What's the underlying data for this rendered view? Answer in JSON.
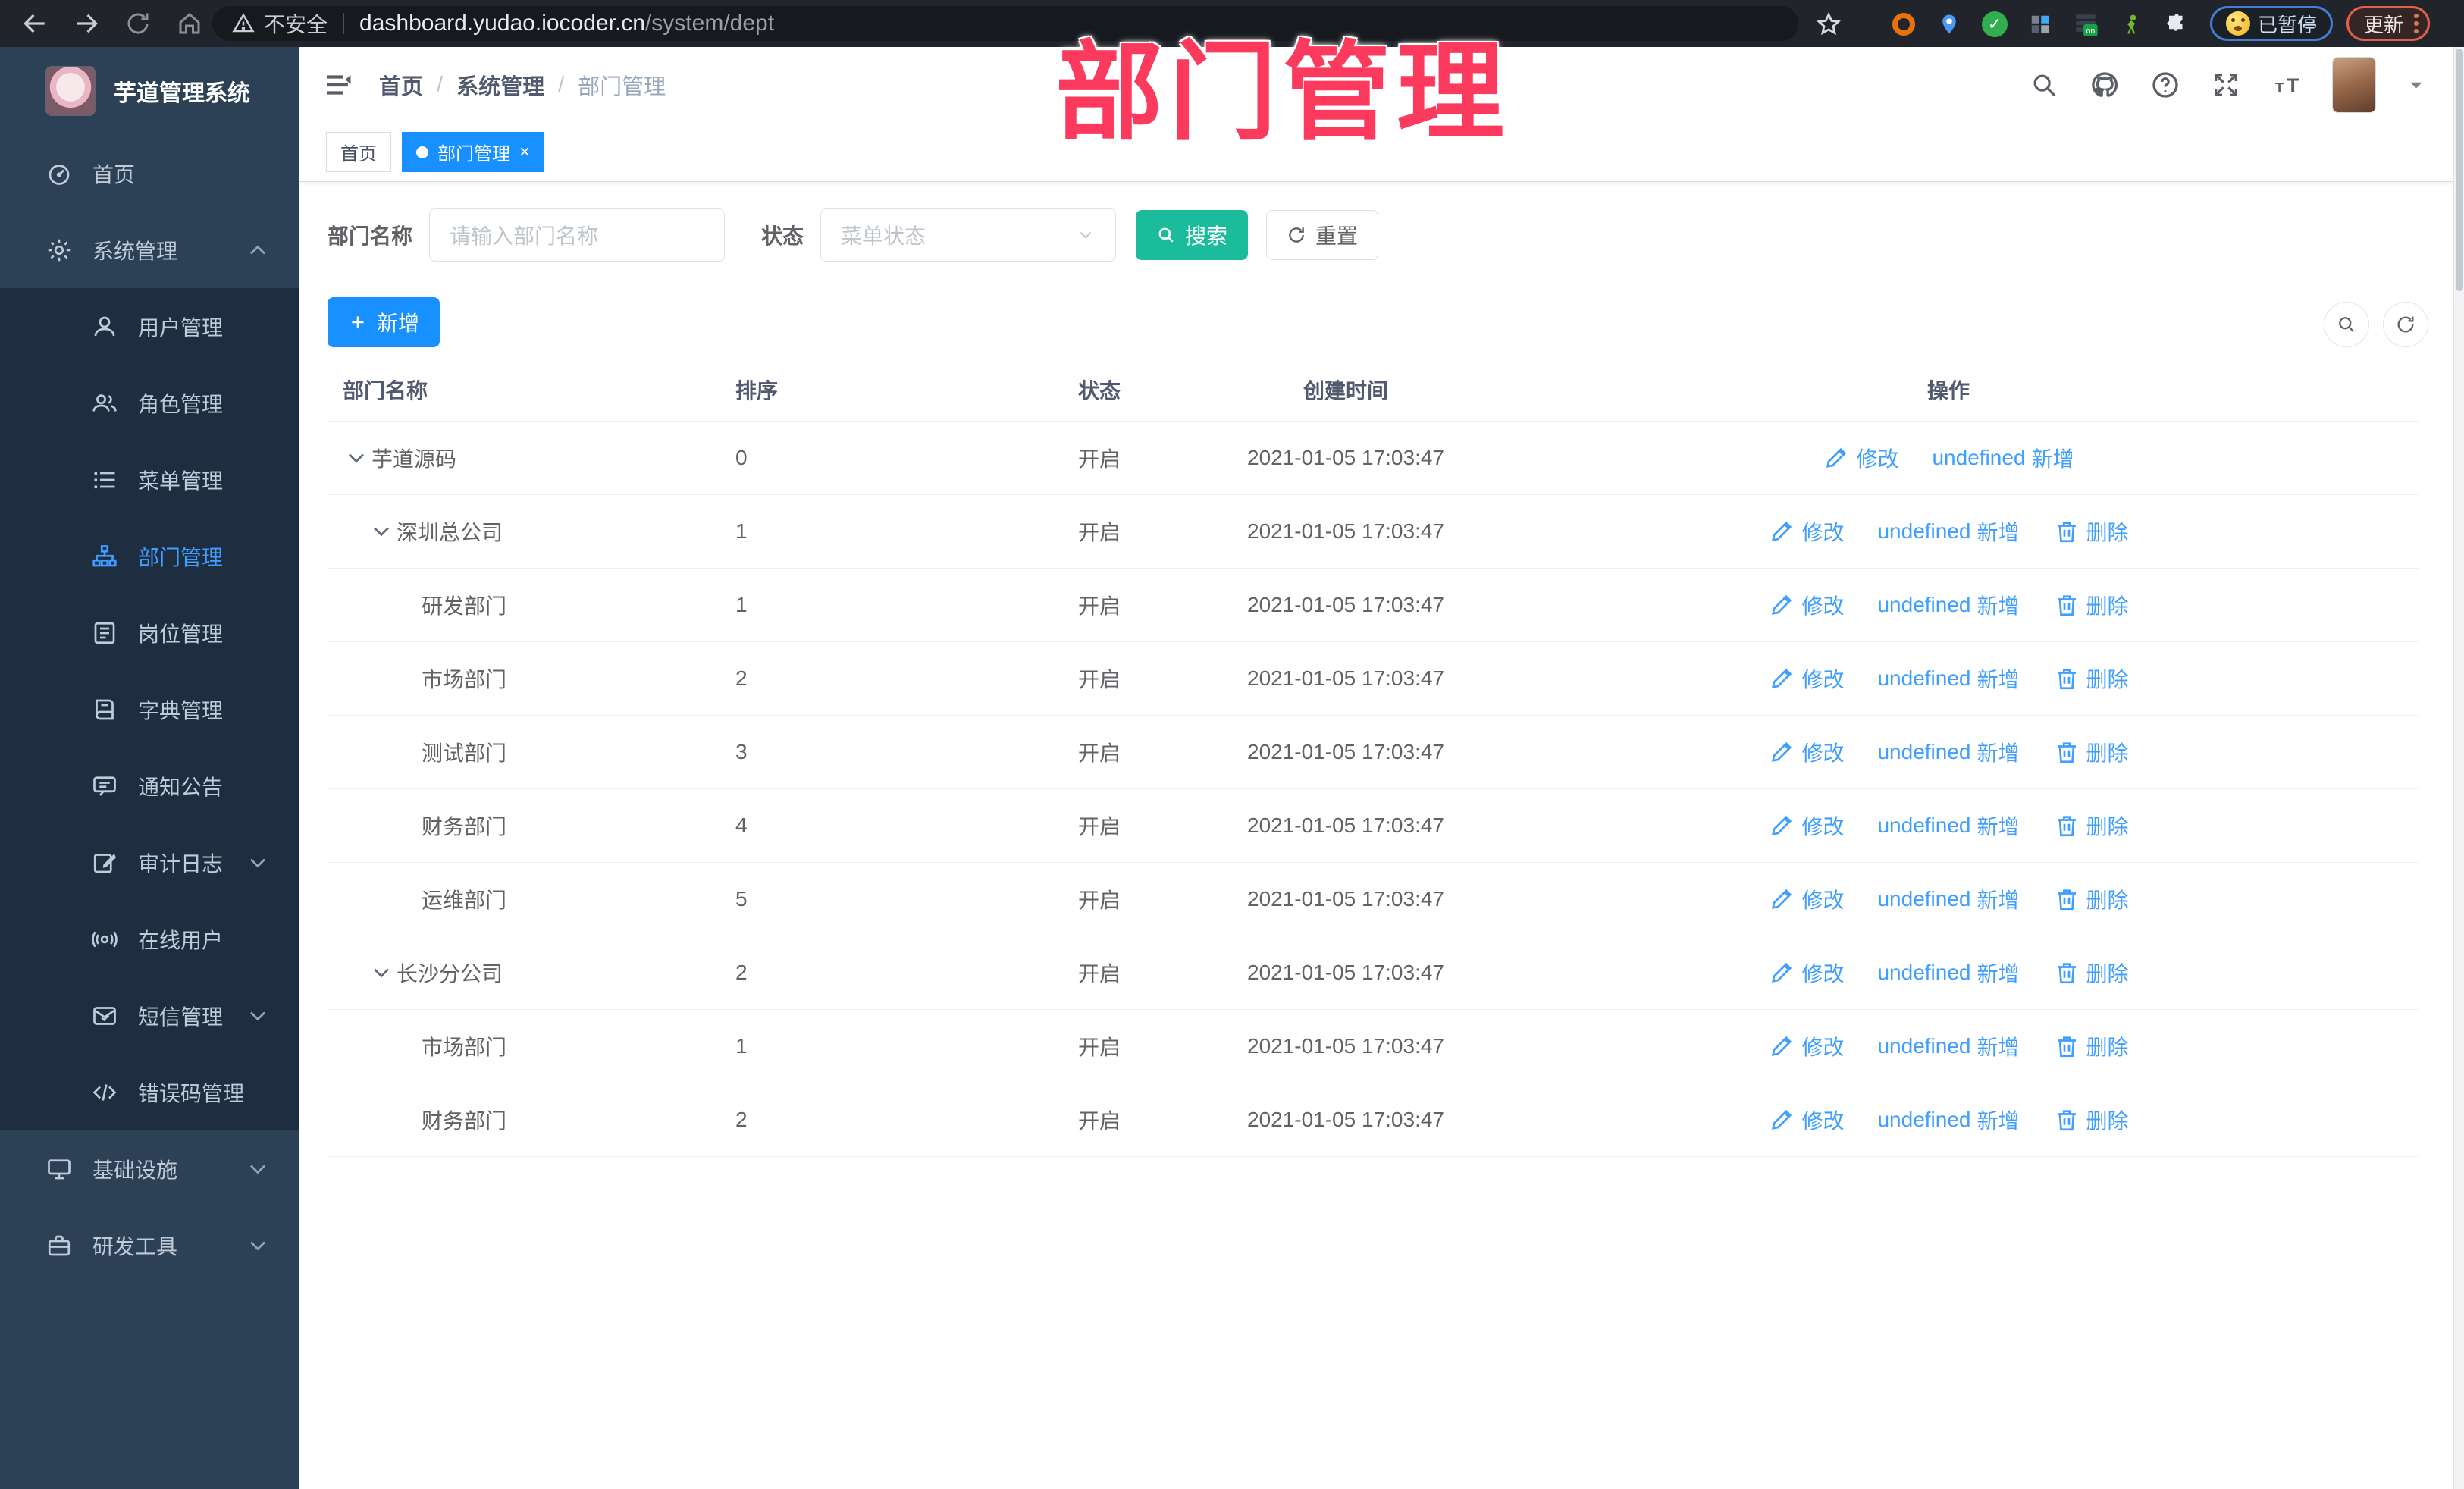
{
  "browser": {
    "security_label": "不安全",
    "url_host": "dashboard.yudao.iocoder.cn",
    "url_path": "/system/dept",
    "paused_label": "已暂停",
    "update_label": "更新"
  },
  "sidebar": {
    "title": "芋道管理系统",
    "menu": [
      {
        "label": "首页",
        "icon": "dashboard-icon",
        "type": "root"
      },
      {
        "label": "系统管理",
        "icon": "gear-icon",
        "type": "root",
        "arrow": "up"
      },
      {
        "label": "用户管理",
        "icon": "user-icon",
        "type": "sub"
      },
      {
        "label": "角色管理",
        "icon": "users-icon",
        "type": "sub"
      },
      {
        "label": "菜单管理",
        "icon": "menu-list-icon",
        "type": "sub"
      },
      {
        "label": "部门管理",
        "icon": "org-tree-icon",
        "type": "sub",
        "active": true
      },
      {
        "label": "岗位管理",
        "icon": "badge-icon",
        "type": "sub"
      },
      {
        "label": "字典管理",
        "icon": "dict-icon",
        "type": "sub"
      },
      {
        "label": "通知公告",
        "icon": "message-icon",
        "type": "sub"
      },
      {
        "label": "审计日志",
        "icon": "log-icon",
        "type": "sub",
        "arrow": "down"
      },
      {
        "label": "在线用户",
        "icon": "online-icon",
        "type": "sub"
      },
      {
        "label": "短信管理",
        "icon": "sms-icon",
        "type": "sub",
        "arrow": "down"
      },
      {
        "label": "错误码管理",
        "icon": "code-icon",
        "type": "sub"
      },
      {
        "label": "基础设施",
        "icon": "infra-icon",
        "type": "root",
        "arrow": "down"
      },
      {
        "label": "研发工具",
        "icon": "tool-icon",
        "type": "root",
        "arrow": "down"
      }
    ]
  },
  "header": {
    "breadcrumb": [
      "首页",
      "系统管理",
      "部门管理"
    ]
  },
  "tags": [
    {
      "label": "首页",
      "active": false
    },
    {
      "label": "部门管理",
      "active": true,
      "closable": true
    }
  ],
  "filter": {
    "name_label": "部门名称",
    "name_placeholder": "请输入部门名称",
    "status_label": "状态",
    "status_placeholder": "菜单状态",
    "search_label": "搜索",
    "reset_label": "重置"
  },
  "table_toolbar": {
    "add_label": "新增"
  },
  "table": {
    "columns": [
      "部门名称",
      "排序",
      "状态",
      "创建时间",
      "操作"
    ],
    "action_labels": {
      "edit": "修改",
      "add": "新增",
      "delete": "删除"
    },
    "rows": [
      {
        "name": "芋道源码",
        "level": 0,
        "expand": true,
        "sort": "0",
        "status": "开启",
        "date": "2021-01-05 17:03:47",
        "actions": [
          "edit",
          "add"
        ]
      },
      {
        "name": "深圳总公司",
        "level": 1,
        "expand": true,
        "sort": "1",
        "status": "开启",
        "date": "2021-01-05 17:03:47",
        "actions": [
          "edit",
          "add",
          "delete"
        ]
      },
      {
        "name": "研发部门",
        "level": 2,
        "expand": false,
        "sort": "1",
        "status": "开启",
        "date": "2021-01-05 17:03:47",
        "actions": [
          "edit",
          "add",
          "delete"
        ]
      },
      {
        "name": "市场部门",
        "level": 2,
        "expand": false,
        "sort": "2",
        "status": "开启",
        "date": "2021-01-05 17:03:47",
        "actions": [
          "edit",
          "add",
          "delete"
        ]
      },
      {
        "name": "测试部门",
        "level": 2,
        "expand": false,
        "sort": "3",
        "status": "开启",
        "date": "2021-01-05 17:03:47",
        "actions": [
          "edit",
          "add",
          "delete"
        ]
      },
      {
        "name": "财务部门",
        "level": 2,
        "expand": false,
        "sort": "4",
        "status": "开启",
        "date": "2021-01-05 17:03:47",
        "actions": [
          "edit",
          "add",
          "delete"
        ]
      },
      {
        "name": "运维部门",
        "level": 2,
        "expand": false,
        "sort": "5",
        "status": "开启",
        "date": "2021-01-05 17:03:47",
        "actions": [
          "edit",
          "add",
          "delete"
        ]
      },
      {
        "name": "长沙分公司",
        "level": 1,
        "expand": true,
        "sort": "2",
        "status": "开启",
        "date": "2021-01-05 17:03:47",
        "actions": [
          "edit",
          "add",
          "delete"
        ]
      },
      {
        "name": "市场部门",
        "level": 2,
        "expand": false,
        "sort": "1",
        "status": "开启",
        "date": "2021-01-05 17:03:47",
        "actions": [
          "edit",
          "add",
          "delete"
        ]
      },
      {
        "name": "财务部门",
        "level": 2,
        "expand": false,
        "sort": "2",
        "status": "开启",
        "date": "2021-01-05 17:03:47",
        "actions": [
          "edit",
          "add",
          "delete"
        ]
      }
    ]
  },
  "overlay": {
    "text": "部门管理"
  },
  "colors": {
    "primary": "#1890ff",
    "link": "#409EFF",
    "teal": "#1ABC9C",
    "overlay_pink": "#fb3a5d",
    "sidebar": "#2d4156",
    "submenu": "#1e2d40"
  }
}
